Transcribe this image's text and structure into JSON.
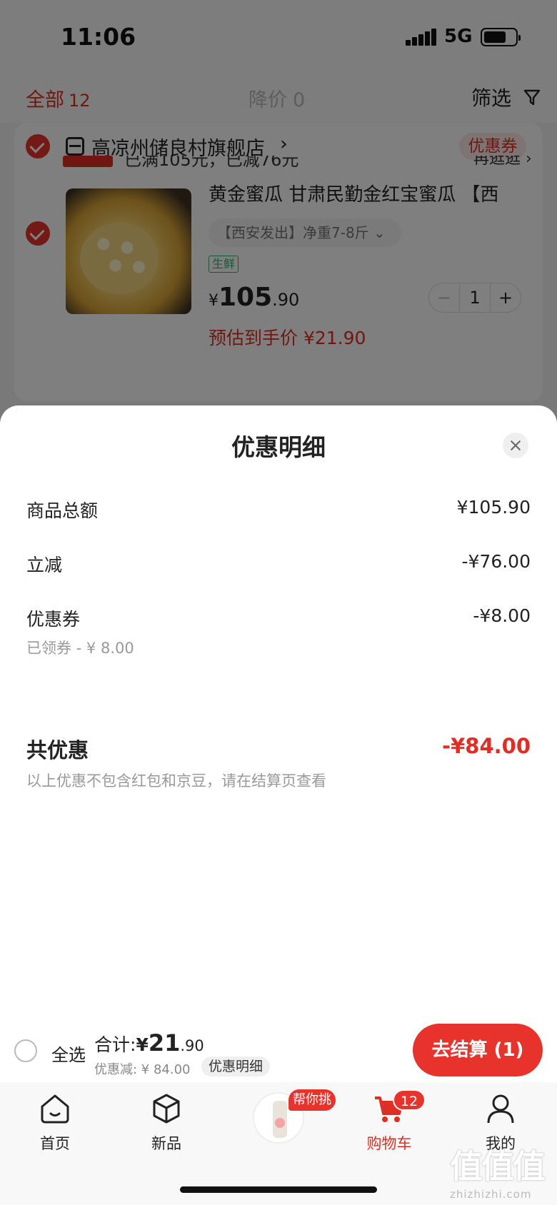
{
  "status_bar": {
    "time": "11:06",
    "network": "5G"
  },
  "filter_bar": {
    "tab_all_label": "全部",
    "tab_all_count": "12",
    "tab_price_drop_label": "降价",
    "tab_price_drop_count": "0",
    "filter_label": "筛选",
    "filter_icon": "funnel-icon"
  },
  "store": {
    "name": "高凉州储良村旗舰店",
    "arrow": "›",
    "coupon_tag": "优惠券",
    "promo_text": "已满105元，已减76元",
    "promo_more": "再逛逛 ›",
    "product": {
      "title": "黄金蜜瓜 甘肃民勤金红宝蜜瓜 【西",
      "spec": "【西安发出】净重7-8斤 ⌄",
      "tag": "生鲜",
      "price_currency": "¥",
      "price_int": "105",
      "price_dec": ".90",
      "quantity": "1",
      "minus": "−",
      "plus": "+",
      "est_price": "预估到手价 ¥21.90"
    }
  },
  "sheet": {
    "title": "优惠明细",
    "close_icon": "close-icon",
    "rows": [
      {
        "label": "商品总额",
        "value": "¥105.90"
      },
      {
        "label": "立减",
        "value": "-¥76.00"
      },
      {
        "label": "优惠券",
        "value": "-¥8.00",
        "sub": "已领券 - ¥ 8.00"
      }
    ],
    "total_label": "共优惠",
    "total_value": "-¥84.00",
    "total_note": "以上优惠不包含红包和京豆，请在结算页查看"
  },
  "settle_bar": {
    "select_all": "全选",
    "sum_label": "合计:",
    "sum_currency": "¥",
    "sum_int": "21",
    "sum_dec": ".90",
    "discount_text": "优惠减: ¥ 84.00",
    "detail_label": "优惠明细",
    "checkout_label": "去结算 (1)"
  },
  "tab_bar": {
    "items": [
      {
        "label": "首页",
        "icon": "home-icon"
      },
      {
        "label": "新品",
        "icon": "cube-icon"
      },
      {
        "label": "购物车",
        "icon": "cart-icon",
        "active": true
      },
      {
        "label": "我的",
        "icon": "person-icon"
      }
    ],
    "pick_badge": "帮你挑",
    "cart_badge": "12",
    "accent_color": "#e02e24"
  },
  "watermark": {
    "logo": "值值值",
    "domain": "zhizhizhi.com"
  }
}
